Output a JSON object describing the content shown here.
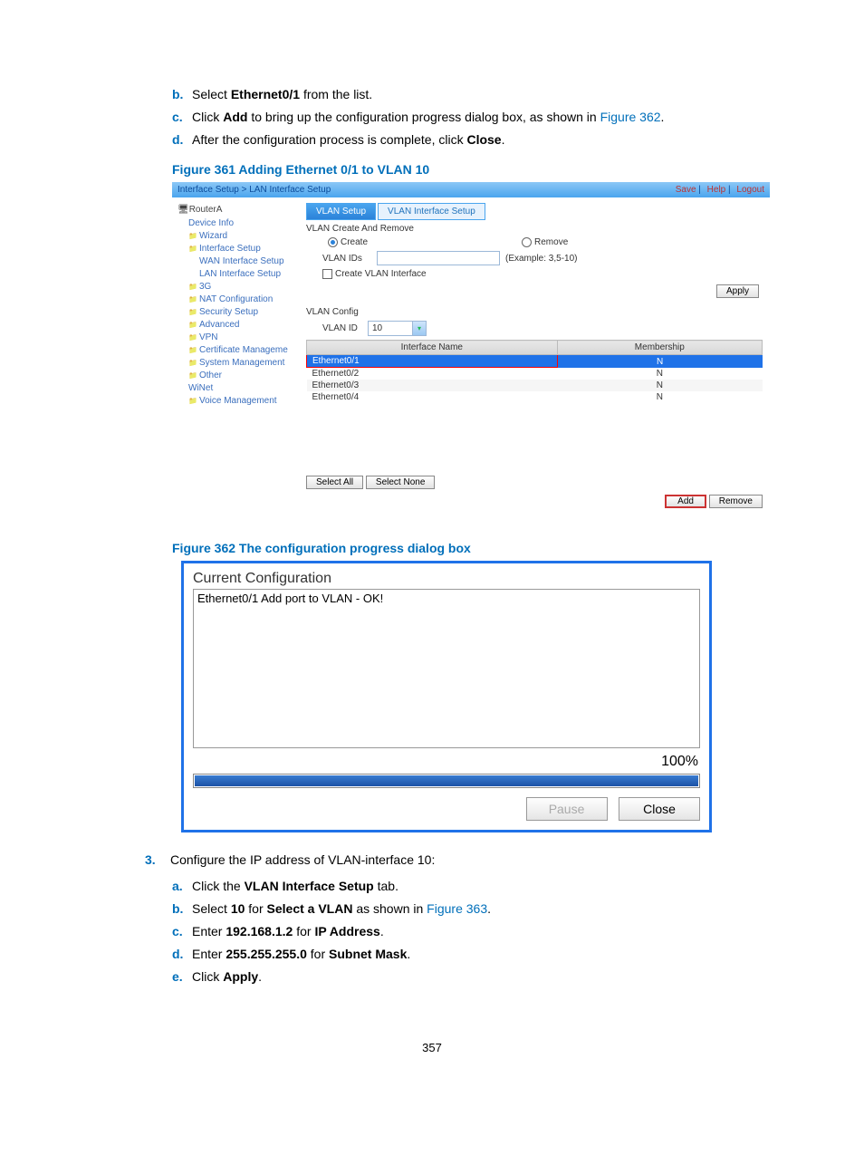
{
  "steps_top": [
    {
      "marker": "b.",
      "html": "Select <b>Ethernet0/1</b> from the list."
    },
    {
      "marker": "c.",
      "html": "Click <b>Add</b> to bring up the configuration progress dialog box, as shown in <span class='link'>Figure 362</span>."
    },
    {
      "marker": "d.",
      "html": "After the configuration process is complete, click <b>Close</b>."
    }
  ],
  "fig361_caption": "Figure 361 Adding Ethernet 0/1 to VLAN 10",
  "fig361": {
    "breadcrumb": "Interface Setup > LAN Interface Setup",
    "top_links": [
      "Save",
      "Help",
      "Logout"
    ],
    "host": "RouterA",
    "nav": [
      {
        "label": "Device Info",
        "cls": "item"
      },
      {
        "label": "Wizard",
        "cls": "item folder"
      },
      {
        "label": "Interface Setup",
        "cls": "item folder"
      },
      {
        "label": "WAN Interface Setup",
        "cls": "subitem"
      },
      {
        "label": "LAN Interface Setup",
        "cls": "subitem"
      },
      {
        "label": "3G",
        "cls": "item folder"
      },
      {
        "label": "NAT Configuration",
        "cls": "item folder"
      },
      {
        "label": "Security Setup",
        "cls": "item folder"
      },
      {
        "label": "Advanced",
        "cls": "item folder"
      },
      {
        "label": "VPN",
        "cls": "item folder"
      },
      {
        "label": "Certificate Manageme",
        "cls": "item folder"
      },
      {
        "label": "System Management",
        "cls": "item folder"
      },
      {
        "label": "Other",
        "cls": "item folder"
      },
      {
        "label": "WiNet",
        "cls": "item"
      },
      {
        "label": "Voice Management",
        "cls": "item folder"
      }
    ],
    "tabs": [
      {
        "label": "VLAN Setup",
        "active": true
      },
      {
        "label": "VLAN Interface Setup",
        "active": false
      }
    ],
    "section1_title": "VLAN Create And Remove",
    "radio_create": "Create",
    "radio_remove": "Remove",
    "vlanids_label": "VLAN IDs",
    "vlanids_example": "(Example: 3,5-10)",
    "checkbox_label": "Create VLAN Interface",
    "apply_btn": "Apply",
    "section2_title": "VLAN Config",
    "vlanid_label": "VLAN ID",
    "vlanid_value": "10",
    "col_if": "Interface Name",
    "col_mem": "Membership",
    "rows": [
      {
        "if": "Ethernet0/1",
        "mem": "N",
        "sel": true
      },
      {
        "if": "Ethernet0/2",
        "mem": "N",
        "sel": false
      },
      {
        "if": "Ethernet0/3",
        "mem": "N",
        "sel": false
      },
      {
        "if": "Ethernet0/4",
        "mem": "N",
        "sel": false
      }
    ],
    "select_all": "Select All",
    "select_none": "Select None",
    "add_btn": "Add",
    "remove_btn": "Remove"
  },
  "fig362_caption": "Figure 362 The configuration progress dialog box",
  "fig362": {
    "title": "Current Configuration",
    "log": "Ethernet0/1 Add port to VLAN - OK!",
    "percent": "100%",
    "pause": "Pause",
    "close": "Close"
  },
  "step3_marker": "3.",
  "step3_text": "Configure the IP address of VLAN-interface 10:",
  "steps_bottom": [
    {
      "marker": "a.",
      "html": "Click the <b>VLAN Interface Setup</b> tab."
    },
    {
      "marker": "b.",
      "html": "Select <b>10</b> for <b>Select a VLAN</b> as shown in <span class='link'>Figure 363</span>."
    },
    {
      "marker": "c.",
      "html": "Enter <b>192.168.1.2</b> for <b>IP Address</b>."
    },
    {
      "marker": "d.",
      "html": "Enter <b>255.255.255.0</b> for <b>Subnet Mask</b>."
    },
    {
      "marker": "e.",
      "html": "Click <b>Apply</b>."
    }
  ],
  "page_number": "357"
}
